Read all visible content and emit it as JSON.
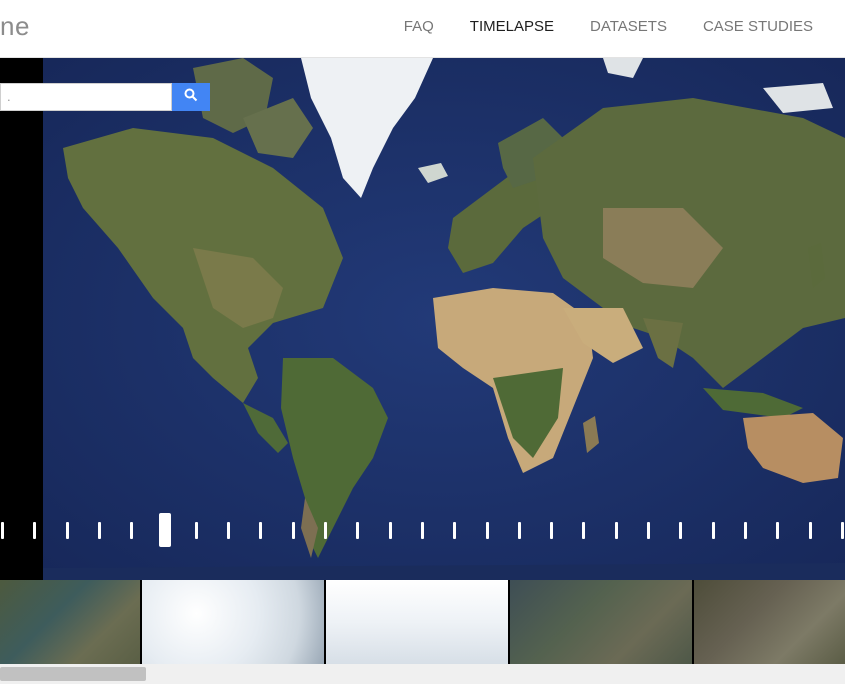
{
  "header": {
    "logo_text": "ne",
    "nav": [
      {
        "label": "FAQ",
        "active": false
      },
      {
        "label": "TIMELAPSE",
        "active": true
      },
      {
        "label": "DATASETS",
        "active": false
      },
      {
        "label": "CASE STUDIES",
        "active": false
      }
    ]
  },
  "search": {
    "value": ".",
    "button_icon": "search-icon",
    "button_color": "#4285f4"
  },
  "timeline": {
    "tick_count": 27,
    "selected_index": 5
  },
  "thumbnails": [
    {
      "name": "thumbnail-coastal-bay"
    },
    {
      "name": "thumbnail-cloudy-1"
    },
    {
      "name": "thumbnail-cloudy-2"
    },
    {
      "name": "thumbnail-bay-city"
    },
    {
      "name": "thumbnail-terrain"
    }
  ],
  "colors": {
    "ocean": "#1c3066",
    "land": "#5c6b3c",
    "desert": "#c8aa7d",
    "ice": "#f1f3f5",
    "accent": "#4285f4"
  }
}
